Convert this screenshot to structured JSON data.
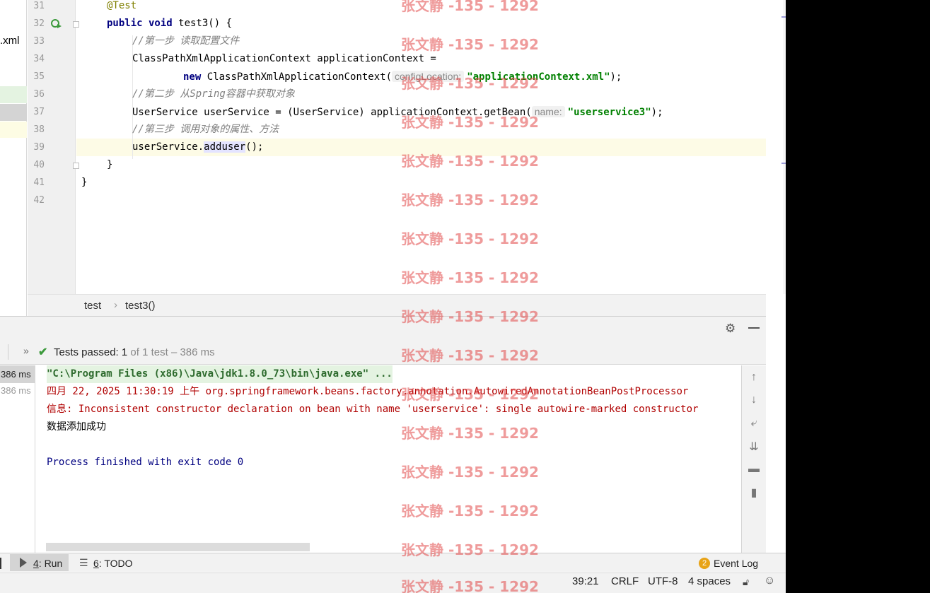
{
  "editor": {
    "line_numbers": [
      "31",
      "32",
      "33",
      "34",
      "35",
      "36",
      "37",
      "38",
      "39",
      "40",
      "41",
      "42"
    ],
    "lines": {
      "l31": "@Test",
      "l32_kw": "public void",
      "l32_rest": " test3() {",
      "l33": "//第一步 读取配置文件",
      "l34": "ClassPathXmlApplicationContext applicationContext =",
      "l35_kw": "new",
      "l35_mid": " ClassPathXmlApplicationContext(",
      "l35_hint": "configLocation:",
      "l35_str": "\"applicationContext.xml\"",
      "l35_end": ");",
      "l36": "//第二步 从Spring容器中获取对象",
      "l37_start": "UserService userService = (UserService) applicationContext.getBean(",
      "l37_hint": "name:",
      "l37_str": "\"userservice3\"",
      "l37_end": ");",
      "l38": "//第三步 调用对象的属性、方法",
      "l39_start": "userService.",
      "l39_method": "adduser",
      "l39_end": "();",
      "l40": "}",
      "l41": "}"
    }
  },
  "project_stub": {
    "file_suffix": ".xml"
  },
  "breadcrumb": {
    "item1": "test",
    "separator": "›",
    "item2": "test3()"
  },
  "run": {
    "tests_passed_label": "Tests passed:",
    "tests_passed_count": "1",
    "tests_total": "of 1 test – 386 ms",
    "tree_row1_time": "386 ms",
    "tree_row2_time": "386 ms",
    "console": [
      "\"C:\\Program Files (x86)\\Java\\jdk1.8.0_73\\bin\\java.exe\" ...",
      "四月 22, 2025 11:30:19 上午 org.springframework.beans.factory.annotation.AutowiredAnnotationBeanPostProcessor",
      "信息: Inconsistent constructor declaration on bean with name 'userservice': single autowire-marked constructor",
      "数据添加成功",
      "",
      "Process finished with exit code 0"
    ]
  },
  "tool_tabs": {
    "run_number": "4",
    "run_label": ": Run",
    "todo_number": "6",
    "todo_label": ": TODO",
    "event_log_count": "2",
    "event_log_label": "Event Log"
  },
  "status_bar": {
    "position": "39:21",
    "line_sep": "CRLF",
    "encoding": "UTF-8",
    "indent": "4 spaces"
  },
  "watermark": {
    "text": "张文静 -135 - 1292"
  },
  "icons": {
    "run_gutter": "run-test-icon",
    "settings": "gear-icon",
    "minimize": "minimize-icon",
    "check": "check-icon",
    "up": "arrow-up-icon",
    "down": "arrow-down-icon",
    "wrap": "soft-wrap-icon",
    "scroll_end": "scroll-to-end-icon",
    "print": "print-icon",
    "trash": "trash-icon",
    "lock": "lock-icon",
    "inspector": "inspector-icon"
  },
  "colors": {
    "keyword": "#000080",
    "string": "#008000",
    "comment": "#808080",
    "annotation": "#808000",
    "success": "#3c9a3c",
    "console_error": "#b00000",
    "watermark": "#e24848"
  }
}
